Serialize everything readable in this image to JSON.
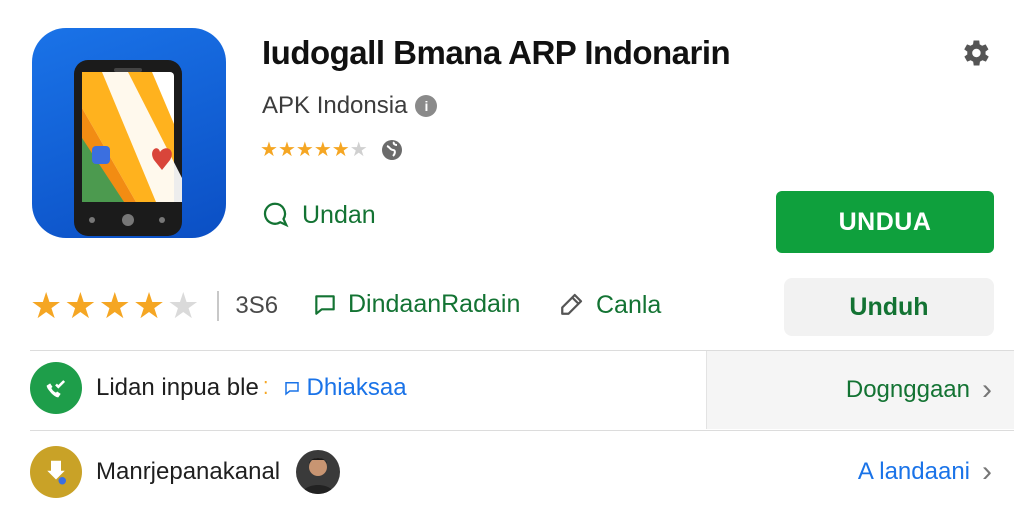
{
  "app": {
    "title": "Iudogall Bmana ARP Indonarin",
    "developer": "APK Indonsia",
    "info_glyph": "i",
    "icon": "app-phone-icon"
  },
  "header": {
    "rating_small_stars": 4.5,
    "globe_icon": "globe-icon",
    "settings_icon": "gear-icon"
  },
  "action_row": {
    "link_label": "Undan",
    "primary_button": "UNDUA"
  },
  "stats_row": {
    "rating_big_stars": 4,
    "review_count": "3S6",
    "chip1_label": "DindaanRadain",
    "chip2_label": "Canla",
    "secondary_button": "Unduh"
  },
  "list": {
    "row1": {
      "label": "Lidan inpua ble",
      "link": "Dhiaksaa",
      "action": "Dognggaan"
    },
    "row2": {
      "label": "Manrjepanakanal",
      "action": "A landaani"
    }
  },
  "colors": {
    "accent_green": "#0fa03d",
    "link_green": "#137333",
    "link_blue": "#1a73e8",
    "star": "#f5a623"
  }
}
